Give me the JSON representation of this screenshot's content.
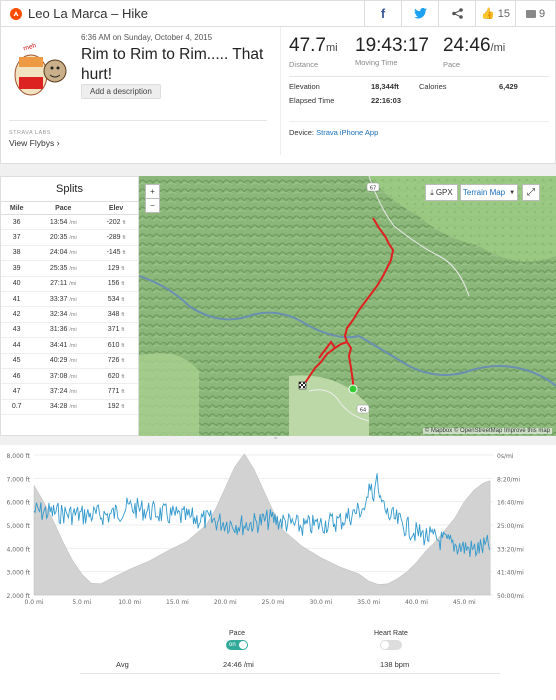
{
  "header": {
    "title": "Leo La Marca – Hike",
    "like_count": "15",
    "comment_count": "9"
  },
  "activity": {
    "datetime": "6:36 AM on Sunday, October 4, 2015",
    "title": "Rim to Rim to Rim..... That hurt!",
    "description_button": "Add a description",
    "labs_label": "STRAVA LABS",
    "flybys_label": "View Flybys"
  },
  "stats": {
    "distance": {
      "value": "47.7",
      "unit": "mi",
      "label": "Distance"
    },
    "moving_time": {
      "value": "19:43:17",
      "label": "Moving Time"
    },
    "pace": {
      "value": "24:46",
      "unit": "/mi",
      "label": "Pace"
    },
    "elevation": {
      "label": "Elevation",
      "value": "18,344ft"
    },
    "calories": {
      "label": "Calories",
      "value": "6,429"
    },
    "elapsed": {
      "label": "Elapsed Time",
      "value": "22:16:03"
    },
    "device_label": "Device:",
    "device_name": "Strava iPhone App"
  },
  "splits": {
    "title": "Splits",
    "headers": [
      "Mile",
      "Pace",
      "Elev"
    ],
    "rows": [
      [
        "36",
        "13:54",
        "-202"
      ],
      [
        "37",
        "20:35",
        "-289"
      ],
      [
        "38",
        "24:04",
        "-145"
      ],
      [
        "39",
        "25:35",
        "129"
      ],
      [
        "40",
        "27:11",
        "156"
      ],
      [
        "41",
        "33:37",
        "534"
      ],
      [
        "42",
        "32:34",
        "348"
      ],
      [
        "43",
        "31:36",
        "371"
      ],
      [
        "44",
        "34:41",
        "610"
      ],
      [
        "45",
        "40:29",
        "726"
      ],
      [
        "46",
        "37:08",
        "620"
      ],
      [
        "47",
        "37:24",
        "771"
      ],
      [
        "0.7",
        "34:28",
        "192"
      ]
    ],
    "pace_unit": "/mi",
    "elev_unit": "ft"
  },
  "map": {
    "gpx": "GPX",
    "terrain": "Terrain Map",
    "zoom_in": "+",
    "zoom_out": "−",
    "attribution": "© Mapbox © OpenStreetMap Improve this map",
    "road_label_1": "67",
    "road_label_2": "64"
  },
  "chart_data": {
    "type": "area",
    "x_ticks": [
      "0.0 mi",
      "5.0 mi",
      "10.0 mi",
      "15.0 mi",
      "20.0 mi",
      "25.0 mi",
      "30.0 mi",
      "35.0 mi",
      "40.0 mi",
      "45.0 mi"
    ],
    "y_left_ticks": [
      "8,000 ft",
      "7,000 ft",
      "6,000 ft",
      "5,000 ft",
      "4,000 ft",
      "3,000 ft",
      "2,000 ft"
    ],
    "y_right_ticks": [
      "0s/mi",
      "8:20/mi",
      "16:40/mi",
      "25:00/mi",
      "33:20/mi",
      "41:40/mi",
      "50:00/mi"
    ],
    "xlim": [
      0,
      48
    ],
    "elev_ylim": [
      2000,
      8000
    ],
    "elevation": {
      "x": [
        0,
        1,
        2,
        3,
        4,
        5,
        6,
        7,
        8,
        10,
        12,
        14,
        16,
        18,
        19,
        20,
        21,
        22,
        23,
        24,
        25,
        26,
        28,
        30,
        32,
        34,
        35,
        36,
        37,
        38,
        39,
        40,
        41,
        42,
        43,
        44,
        45,
        46,
        47,
        47.7
      ],
      "y": [
        6700,
        6000,
        5200,
        4300,
        3500,
        2900,
        2500,
        2480,
        2700,
        3100,
        3450,
        3900,
        4300,
        5000,
        5700,
        6600,
        7500,
        8050,
        7400,
        6500,
        5600,
        4800,
        4100,
        3600,
        3200,
        2900,
        2600,
        2450,
        2480,
        2700,
        3000,
        3400,
        3900,
        4300,
        4800,
        5300,
        6000,
        6500,
        6800,
        6900
      ]
    },
    "pace_series_name": "Pace",
    "avg_label": "Avg",
    "avg_pace": "24:46 /mi",
    "avg_hr": "138 bpm",
    "hr_series_name": "Heart Rate",
    "pace_toggle": "on"
  },
  "colors": {
    "orange": "#fc4c02",
    "route": "#e02020",
    "pace": "#3399cc",
    "elev": "#c8c8c8",
    "link": "#1a6eb8"
  }
}
